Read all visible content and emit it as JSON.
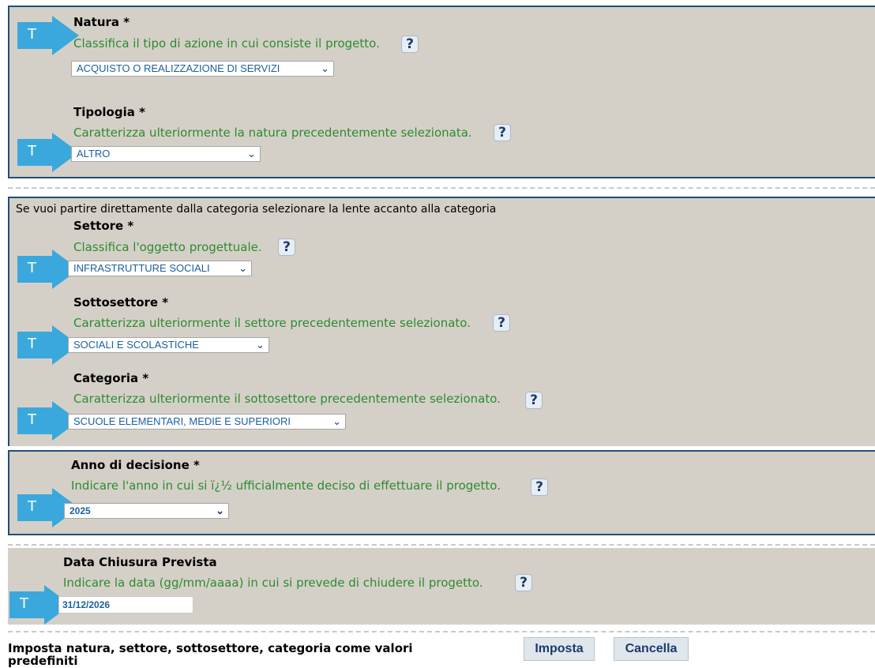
{
  "natura": {
    "title": "Natura *",
    "description": "Classifica il tipo di azione in cui consiste il progetto.",
    "help": "?",
    "selected": "ACQUISTO O REALIZZAZIONE DI SERVIZI"
  },
  "tipologia": {
    "title": "Tipologia *",
    "description": "Caratterizza ulteriormente la natura precedentemente selezionata.",
    "help": "?",
    "selected": "ALTRO"
  },
  "category_hint": "Se vuoi partire direttamente dalla categoria selezionare la lente accanto alla categoria",
  "settore": {
    "title": "Settore *",
    "description": "Classifica l'oggetto progettuale.",
    "help": "?",
    "selected": "INFRASTRUTTURE SOCIALI"
  },
  "sottosettore": {
    "title": "Sottosettore *",
    "description": "Caratterizza ulteriormente il settore precedentemente selezionato.",
    "help": "?",
    "selected": "SOCIALI E SCOLASTICHE"
  },
  "categoria": {
    "title": "Categoria *",
    "description": "Caratterizza ulteriormente il sottosettore precedentemente selezionato.",
    "help": "?",
    "selected": "SCUOLE ELEMENTARI, MEDIE E SUPERIORI"
  },
  "anno": {
    "title": "Anno di decisione *",
    "description": "Indicare l'anno in cui si ï¿½ ufficialmente deciso di effettuare il progetto.",
    "help": "?",
    "selected": "2025"
  },
  "data_chiusura": {
    "title": "Data Chiusura Prevista",
    "description": "Indicare la data (gg/mm/aaaa) in cui si prevede di chiudere il progetto.",
    "help": "?",
    "value": "31/12/2026"
  },
  "footer": {
    "text": "Imposta natura, settore, sottosettore, categoria come valori predefiniti",
    "imposta_label": "Imposta",
    "cancella_label": "Cancella"
  },
  "marker_letter": "T",
  "colors": {
    "panel_bg": "#d4d0c8",
    "frame": "#1f4e79",
    "description_green": "#2e8b2e",
    "arrow": "#3aa8dc"
  }
}
